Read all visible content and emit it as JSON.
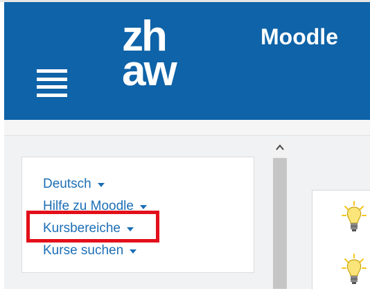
{
  "header": {
    "logo_line1": "zh",
    "logo_line2": "aw",
    "app_title": "Moodle",
    "brand_color": "#0f63a8"
  },
  "sidebar": {
    "items": [
      {
        "label": "Deutsch"
      },
      {
        "label": "Hilfe zu Moodle"
      },
      {
        "label": "Kursbereiche"
      },
      {
        "label": "Kurse suchen"
      }
    ],
    "highlight_color": "#e20f1b"
  },
  "icons": {
    "menu": "hamburger-menu-icon",
    "bulb": "lightbulb-icon",
    "scroll_up": "scroll-up-arrow-icon"
  }
}
